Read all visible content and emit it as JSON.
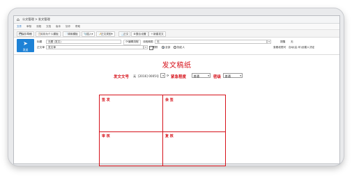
{
  "window": {
    "breadcrumb": "公文管理 > 发文管理",
    "tabs": [
      "文件",
      "审核",
      "流程",
      "文档",
      "版本",
      "协作",
      "帮助"
    ]
  },
  "toolbar": {
    "buttons": [
      {
        "label": "保存草稿",
        "icon": "💾"
      },
      {
        "label": "另存为个人模板",
        "icon": "📋"
      },
      {
        "label": "调用模板",
        "icon": "📄"
      },
      {
        "label": "插入",
        "icon": "📎",
        "caret": "▾"
      },
      {
        "label": "正文类型",
        "icon": "📝",
        "caret": "▾"
      },
      {
        "label": "正文",
        "icon": "📃"
      },
      {
        "label": "整合设置",
        "icon": "⚙"
      },
      {
        "label": "新建发文",
        "icon": "＋"
      }
    ]
  },
  "send": {
    "label": "发送",
    "icon": "➤"
  },
  "form": {
    "title_label": "标题",
    "title_value": "无题 (发文)",
    "flow_button": "编辑流程",
    "flow_label": "流程期限",
    "flow_value": "无",
    "urgency_label": "提醒",
    "urgency_value": "无",
    "body_label": "正文单",
    "body_value": "发文单",
    "track_label": "跟踪",
    "track_all": "全部",
    "track_specified": "指定人",
    "permission_label": "查看权限可",
    "permission_value": "自动(由 印)创建人决定"
  },
  "doc": {
    "title": "发文稿纸",
    "number_label": "发文文号",
    "number_value": "[2016] 0005号",
    "number_prefix": "无",
    "urgency_label": "紧急程度",
    "urgency_value": "普通",
    "secret_label": "密级",
    "secret_value": "普通",
    "cells": {
      "sign": "签 发",
      "countersign": "会 签",
      "review": "审 核",
      "verify": "复 核"
    }
  },
  "colors": {
    "accent": "#1e82d6",
    "doc_red": "#d6111a"
  }
}
